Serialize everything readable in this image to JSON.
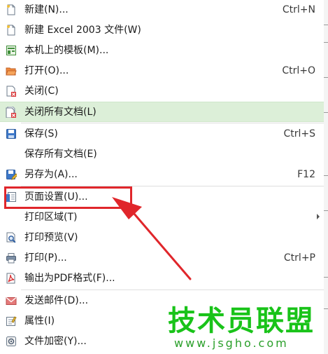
{
  "menu": {
    "items": [
      {
        "label": "新建(N)...",
        "shortcut": "Ctrl+N",
        "icon": "new-document-icon"
      },
      {
        "label": "新建 Excel 2003 文件(W)",
        "shortcut": "",
        "icon": "new-excel-document-icon"
      },
      {
        "label": "本机上的模板(M)...",
        "shortcut": "",
        "icon": "template-icon"
      },
      {
        "label": "打开(O)...",
        "shortcut": "Ctrl+O",
        "icon": "open-folder-icon"
      },
      {
        "label": "关闭(C)",
        "shortcut": "",
        "icon": "close-document-icon"
      },
      {
        "label": "关闭所有文档(L)",
        "shortcut": "",
        "icon": "close-all-documents-icon"
      },
      {
        "label": "保存(S)",
        "shortcut": "Ctrl+S",
        "icon": "save-icon"
      },
      {
        "label": "保存所有文档(E)",
        "shortcut": "",
        "icon": ""
      },
      {
        "label": "另存为(A)...",
        "shortcut": "F12",
        "icon": "save-as-icon"
      },
      {
        "label": "页面设置(U)...",
        "shortcut": "",
        "icon": "page-setup-icon"
      },
      {
        "label": "打印区域(T)",
        "shortcut": "",
        "icon": ""
      },
      {
        "label": "打印预览(V)",
        "shortcut": "",
        "icon": "print-preview-icon"
      },
      {
        "label": "打印(P)...",
        "shortcut": "Ctrl+P",
        "icon": "printer-icon"
      },
      {
        "label": "输出为PDF格式(F)...",
        "shortcut": "",
        "icon": "pdf-icon"
      },
      {
        "label": "发送邮件(D)...",
        "shortcut": "",
        "icon": "mail-icon"
      },
      {
        "label": "属性(I)",
        "shortcut": "",
        "icon": "properties-icon"
      },
      {
        "label": "文件加密(Y)...",
        "shortcut": "",
        "icon": "encrypt-icon"
      }
    ],
    "highlighted_item": "关闭所有文档(L)",
    "annotated_item": "页面设置(U)..."
  },
  "watermark": {
    "title": "技术员联盟",
    "url": "www.jsgho.com"
  },
  "colors": {
    "highlight": "#dcefd8",
    "annotation_red": "#e0262b",
    "watermark_green": "#19c319"
  }
}
